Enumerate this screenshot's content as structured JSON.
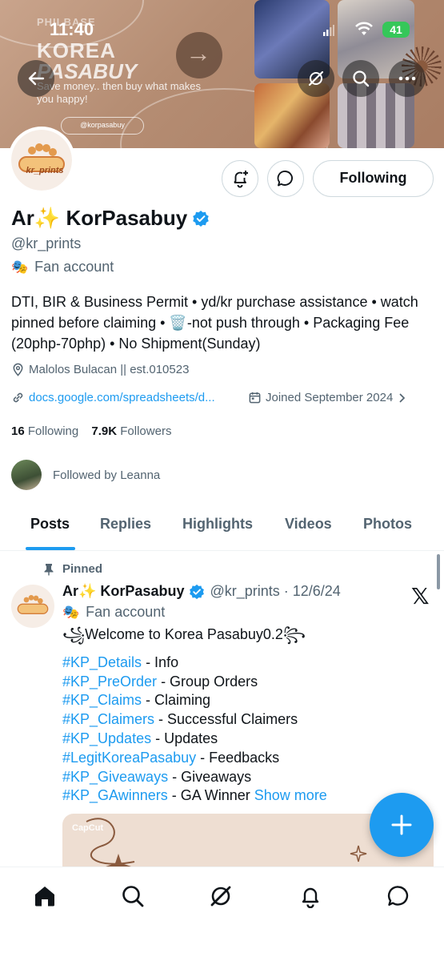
{
  "status_bar": {
    "time": "11:40",
    "battery": "41"
  },
  "banner": {
    "line1": "PHILBASE",
    "line2": "KOREA",
    "line3": "PASABUY",
    "tagline": "Save money.. then buy what makes you happy!",
    "handle": "@korpasabuy"
  },
  "profile": {
    "name": "Ar✨ KorPasabuy",
    "handle": "@kr_prints",
    "category": "Fan account",
    "bio": "DTI, BIR & Business Permit • yd/kr purchase assistance • watch pinned before claiming • 🗑️-not push through • Packaging Fee (20php-70php) • No Shipment(Sunday)",
    "location": "Malolos Bulacan || est.010523",
    "website": "docs.google.com/spreadsheets/d...",
    "joined": "Joined September 2024",
    "following_count": "16",
    "following_label": "Following",
    "followers_count": "7.9K",
    "followers_label": "Followers",
    "followed_by": "Followed by Leanna",
    "follow_button": "Following"
  },
  "avatar_text": "kr_prints",
  "tabs": [
    "Posts",
    "Replies",
    "Highlights",
    "Videos",
    "Photos"
  ],
  "post": {
    "pinned_label": "Pinned",
    "name": "Ar✨ KorPasabuy",
    "handle_date": "@kr_prints · 12/6/24",
    "category": "Fan account",
    "lines": [
      {
        "tag": "",
        "text": "꧁Welcome to Korea Pasabuy0.2꧂"
      },
      {
        "tag": "#KP_Details",
        "text": " - Info"
      },
      {
        "tag": "#KP_PreOrder",
        "text": " - Group Orders"
      },
      {
        "tag": "#KP_Claims",
        "text": " - Claiming"
      },
      {
        "tag": "#KP_Claimers",
        "text": " - Successful Claimers"
      },
      {
        "tag": "#KP_Updates",
        "text": " - Updates"
      },
      {
        "tag": "#LegitKoreaPasabuy",
        "text": " - Feedbacks"
      },
      {
        "tag": "#KP_Giveaways",
        "text": " - Giveaways"
      },
      {
        "tag": "#KP_GAwinners",
        "text": " - GA Winner "
      }
    ],
    "show_more": "Show more",
    "media_watermark": "CapCut"
  },
  "colors": {
    "accent": "#1d9bf0",
    "text": "#0f1419",
    "muted": "#536471"
  }
}
